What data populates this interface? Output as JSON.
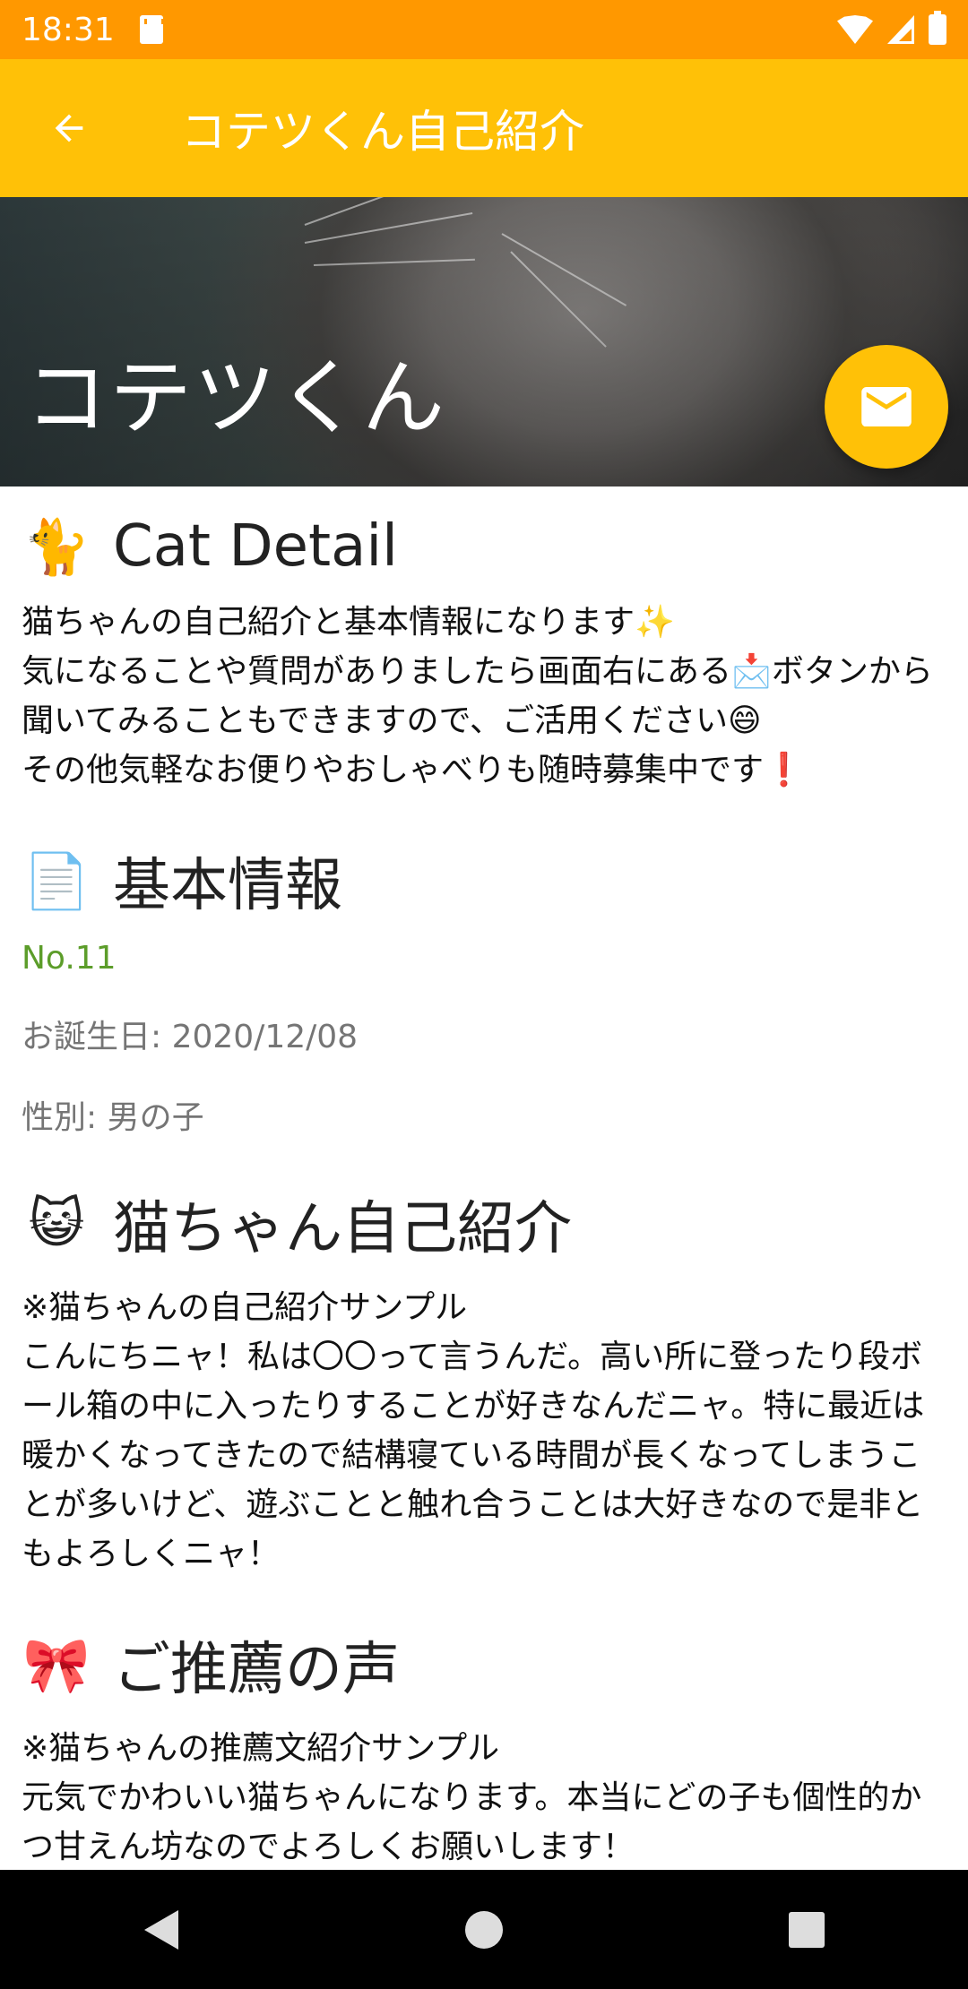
{
  "status_bar": {
    "time": "18:31"
  },
  "app_bar": {
    "title": "コテツくん自己紹介"
  },
  "header": {
    "cat_name": "コテツくん"
  },
  "sections": {
    "detail": {
      "emoji": "🐈",
      "title": "Cat Detail",
      "text": "猫ちゃんの自己紹介と基本情報になります✨\n気になることや質問がありましたら画面右にある📩ボタンから聞いてみることもできますので、ご活用ください😄\nその他気軽なお便りやおしゃべりも随時募集中です❗"
    },
    "basic_info": {
      "emoji": "📄",
      "title": "基本情報",
      "number": "No.11",
      "birthday": "お誕生日: 2020/12/08",
      "gender": "性別: 男の子"
    },
    "self_intro": {
      "emoji": "😺",
      "title": "猫ちゃん自己紹介",
      "text": "※猫ちゃんの自己紹介サンプル\nこんにちニャ！私は〇〇って言うんだ。高い所に登ったり段ボール箱の中に入ったりすることが好きなんだニャ。特に最近は暖かくなってきたので結構寝ている時間が長くなってしまうことが多いけど、遊ぶことと触れ合うことは大好きなので是非ともよろしくニャ！"
    },
    "recommendation": {
      "emoji": "🎀",
      "title": "ご推薦の声",
      "text": "※猫ちゃんの推薦文紹介サンプル\n元気でかわいい猫ちゃんになります。本当にどの子も個性的かつ甘えん坊なのでよろしくお願いします！"
    }
  },
  "icons": {
    "back": "arrow-back-icon",
    "mail": "mail-icon"
  },
  "colors": {
    "status_bar": "#FF9800",
    "app_bar": "#FFC107",
    "fab": "#FFC107",
    "number_text": "#5c9d2a",
    "info_text": "#757575"
  }
}
